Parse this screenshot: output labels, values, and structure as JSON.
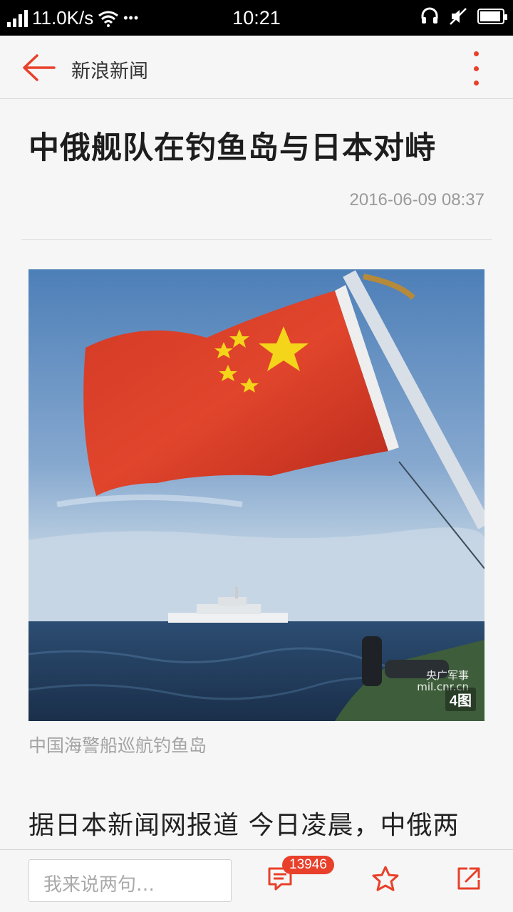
{
  "status_bar": {
    "net_speed": "11.0K/s",
    "dots": "•••",
    "time": "10:21"
  },
  "header": {
    "app_title": "新浪新闻"
  },
  "article": {
    "headline": "中俄舰队在钓鱼岛与日本对峙",
    "timestamp": "2016-06-09 08:37",
    "photo": {
      "count_label": "4图",
      "watermark": "央广军事\nmil.cnr.cn"
    },
    "caption": "中国海警船巡航钓鱼岛",
    "body_first_line": "据日本新闻网报道 今日凌晨，中俄两"
  },
  "bottom_bar": {
    "comment_placeholder": "我来说两句…",
    "comment_count": "13946"
  },
  "colors": {
    "accent": "#e8402a",
    "background": "#f6f6f6",
    "text_secondary": "#9a9a9a"
  }
}
